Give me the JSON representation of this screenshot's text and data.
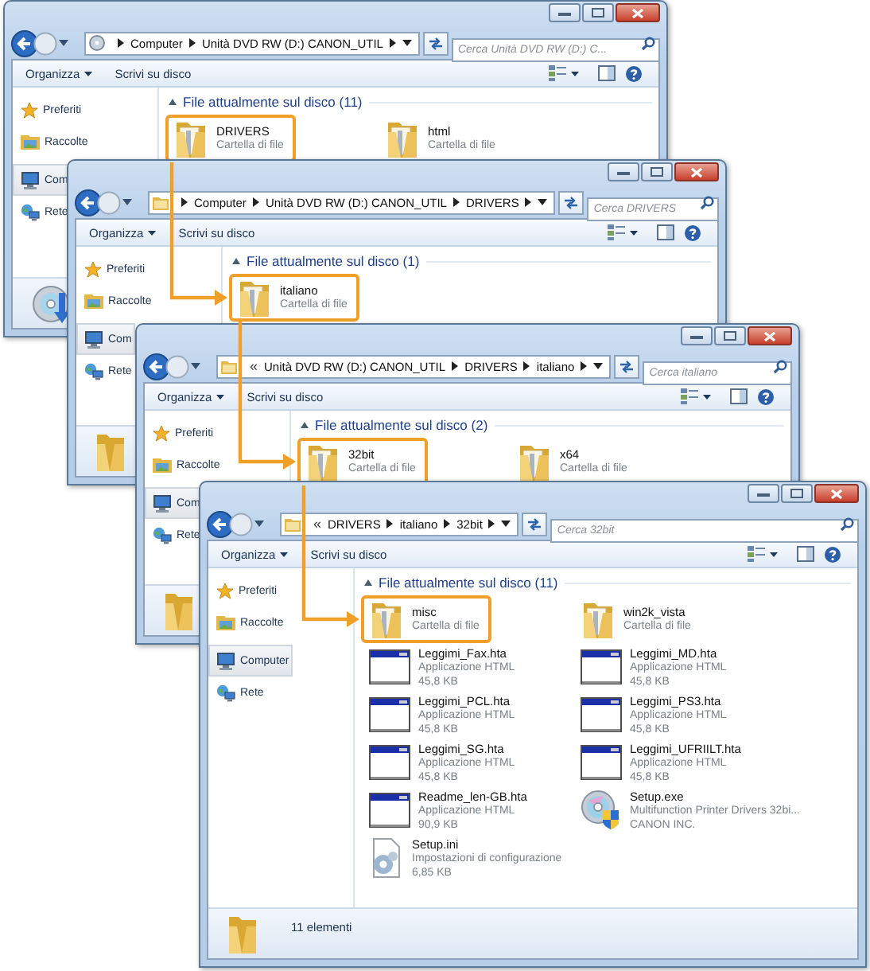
{
  "windows": [
    {
      "address": {
        "kind": "drive",
        "segments": [
          "Computer",
          "Unità DVD RW (D:) CANON_UTIL"
        ]
      },
      "search": {
        "placeholder": "Cerca Unità DVD RW (D:) C..."
      },
      "toolbar": {
        "menu": "Organizza",
        "button": "Scrivi su disco"
      },
      "sidebar": [
        {
          "label": "Preferiti",
          "kind": "favorites",
          "selected": false
        },
        {
          "label": "Raccolte",
          "kind": "libraries",
          "selected": false
        },
        {
          "label": "Com",
          "kind": "computer",
          "selected": true
        },
        {
          "label": "Rete",
          "kind": "network",
          "selected": false
        }
      ],
      "section": {
        "title": "File attualmente sul disco (11)",
        "expanded": true
      },
      "items": [
        {
          "name": "DRIVERS",
          "kind": "folder",
          "details": [
            "Cartella di file"
          ],
          "highlighted": true
        },
        {
          "name": "html",
          "kind": "folder",
          "details": [
            "Cartella di file"
          ],
          "highlighted": false
        }
      ],
      "status_bar": {
        "kind": "dvd"
      }
    },
    {
      "address": {
        "kind": "folder",
        "segments": [
          "Computer",
          "Unità DVD RW (D:) CANON_UTIL",
          "DRIVERS"
        ]
      },
      "search": {
        "placeholder": "Cerca DRIVERS"
      },
      "toolbar": {
        "menu": "Organizza",
        "button": "Scrivi su disco"
      },
      "sidebar": [
        {
          "label": "Preferiti",
          "kind": "favorites",
          "selected": false
        },
        {
          "label": "Raccolte",
          "kind": "libraries",
          "selected": false
        },
        {
          "label": "Com",
          "kind": "computer",
          "selected": true
        },
        {
          "label": "Rete",
          "kind": "network",
          "selected": false
        }
      ],
      "section": {
        "title": "File attualmente sul disco (1)",
        "expanded": true
      },
      "items": [
        {
          "name": "italiano",
          "kind": "folder",
          "details": [
            "Cartella di file"
          ],
          "highlighted": true
        }
      ],
      "status_bar": {
        "kind": "folder"
      }
    },
    {
      "address": {
        "kind": "folder",
        "overflow_mark": "«",
        "segments": [
          "Unità DVD RW (D:) CANON_UTIL",
          "DRIVERS",
          "italiano"
        ]
      },
      "search": {
        "placeholder": "Cerca italiano"
      },
      "toolbar": {
        "menu": "Organizza",
        "button": "Scrivi su disco"
      },
      "sidebar": [
        {
          "label": "Preferiti",
          "kind": "favorites",
          "selected": false
        },
        {
          "label": "Raccolte",
          "kind": "libraries",
          "selected": false
        },
        {
          "label": "Com",
          "kind": "computer",
          "selected": true
        },
        {
          "label": "Rete",
          "kind": "network",
          "selected": false
        }
      ],
      "section": {
        "title": "File attualmente sul disco (2)",
        "expanded": true
      },
      "items": [
        {
          "name": "32bit",
          "kind": "folder",
          "details": [
            "Cartella di file"
          ],
          "highlighted": true
        },
        {
          "name": "x64",
          "kind": "folder",
          "details": [
            "Cartella di file"
          ],
          "highlighted": false
        }
      ],
      "status_bar": {
        "kind": "folder"
      }
    },
    {
      "address": {
        "kind": "folder",
        "overflow_mark": "«",
        "segments": [
          "DRIVERS",
          "italiano",
          "32bit"
        ]
      },
      "search": {
        "placeholder": "Cerca 32bit"
      },
      "toolbar": {
        "menu": "Organizza",
        "button": "Scrivi su disco"
      },
      "sidebar": [
        {
          "label": "Preferiti",
          "kind": "favorites",
          "selected": false
        },
        {
          "label": "Raccolte",
          "kind": "libraries",
          "selected": false
        },
        {
          "label": "Computer",
          "kind": "computer",
          "selected": true
        },
        {
          "label": "Rete",
          "kind": "network",
          "selected": false
        }
      ],
      "section": {
        "title": "File attualmente sul disco (11)",
        "expanded": true
      },
      "items": [
        {
          "name": "misc",
          "kind": "folder",
          "details": [
            "Cartella di file"
          ],
          "highlighted": true
        },
        {
          "name": "win2k_vista",
          "kind": "folder",
          "details": [
            "Cartella di file"
          ],
          "highlighted": false
        },
        {
          "name": "Leggimi_Fax.hta",
          "kind": "hta",
          "details": [
            "Applicazione HTML",
            "45,8 KB"
          ],
          "highlighted": false
        },
        {
          "name": "Leggimi_MD.hta",
          "kind": "hta",
          "details": [
            "Applicazione HTML",
            "45,8 KB"
          ],
          "highlighted": false
        },
        {
          "name": "Leggimi_PCL.hta",
          "kind": "hta",
          "details": [
            "Applicazione HTML",
            "45,8 KB"
          ],
          "highlighted": false
        },
        {
          "name": "Leggimi_PS3.hta",
          "kind": "hta",
          "details": [
            "Applicazione HTML",
            "45,8 KB"
          ],
          "highlighted": false
        },
        {
          "name": "Leggimi_SG.hta",
          "kind": "hta",
          "details": [
            "Applicazione HTML",
            "45,8 KB"
          ],
          "highlighted": false
        },
        {
          "name": "Leggimi_UFRIILT.hta",
          "kind": "hta",
          "details": [
            "Applicazione HTML",
            "45,8 KB"
          ],
          "highlighted": false
        },
        {
          "name": "Readme_len-GB.hta",
          "kind": "hta",
          "details": [
            "Applicazione HTML",
            "90,9 KB"
          ],
          "highlighted": false
        },
        {
          "name": "Setup.exe",
          "kind": "setup",
          "details": [
            "Multifunction Printer Drivers 32bi...",
            "CANON INC."
          ],
          "highlighted": false
        },
        {
          "name": "Setup.ini",
          "kind": "ini",
          "details": [
            "Impostazioni di configurazione",
            "6,85 KB"
          ],
          "highlighted": false
        }
      ],
      "status_bar": {
        "kind": "folder",
        "text": "11 elementi"
      }
    }
  ]
}
